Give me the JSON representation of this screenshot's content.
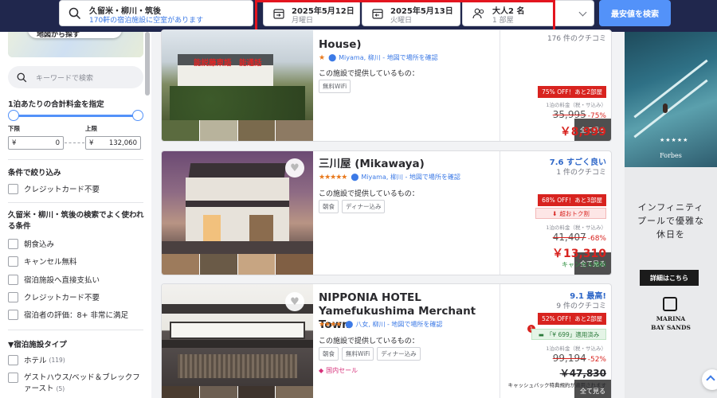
{
  "search": {
    "destination": "久留米・柳川・筑後",
    "availability": "170軒の宿泊施設に空室があります",
    "checkin_date": "2025年5月12日",
    "checkin_day": "月曜日",
    "checkout_date": "2025年5月13日",
    "checkout_day": "火曜日",
    "guests": "大人2 名",
    "rooms": "1 部屋",
    "button": "最安値を検索"
  },
  "map": {
    "label": "地図から探す"
  },
  "sidebar": {
    "keyword_placeholder": "キーワードで検索",
    "price_title": "1泊あたりの合計料金を指定",
    "min_label": "下限",
    "max_label": "上限",
    "currency": "¥",
    "min_value": "0",
    "max_value": "132,060",
    "filters_title": "条件で絞り込み",
    "filters": [
      "クレジットカード不要"
    ],
    "popular_title": "久留米・柳川・筑後の検索でよく使われる条件",
    "popular": [
      "朝食込み",
      "キャンセル無料",
      "宿泊施設へ直接支払い",
      "クレジットカード不要",
      "宿泊者の評価：8+ 非常に満足"
    ],
    "type_title": "▼宿泊施設タイプ",
    "types": [
      {
        "label": "ホテル",
        "count": "(119)"
      },
      {
        "label": "ゲストハウス/ベッド＆ブレックファースト",
        "count": "(5)"
      }
    ]
  },
  "hotels": [
    {
      "name": "House)",
      "photo_text": "能説藤東語　能通話",
      "location": "Miyama, 柳川 - 地図で場所を確認",
      "amenities_label": "この施設で提供しているもの：",
      "tags": [
        "無料WiFi"
      ],
      "see_all": "全て見る",
      "review_count": "176 件のクチコミ",
      "badge": "75% OFF！あと2部屋",
      "per_night": "1泊の料金（税・サ込み）",
      "old_price": "35,995",
      "discount": "-75%",
      "price": "￥8,999",
      "stars": 1
    },
    {
      "name": "三川屋 (Mikawaya)",
      "location": "Miyama, 柳川 - 地図で場所を確認",
      "amenities_label": "この施設で提供しているもの：",
      "tags": [
        "朝食",
        "ディナー込み"
      ],
      "see_all": "全て見る",
      "rating": "7.6 すごく良い",
      "review_count": "1 件のクチコミ",
      "badge": "68% OFF！あと3部屋",
      "deal": "超おトク割",
      "per_night": "1泊の料金（税・サ込み）",
      "old_price": "41,407",
      "discount": "-68%",
      "price": "￥13,310",
      "cancel": "キャンセル無料",
      "stars": 5
    },
    {
      "name": "NIPPONIA HOTEL Yamefukushima Merchant Town",
      "location": "八女, 柳川 - 地図で場所を確認",
      "amenities_label": "この施設で提供しているもの：",
      "tags": [
        "朝食",
        "無料WiFi",
        "ディナー込み"
      ],
      "promo": "国内セール",
      "see_all": "全て見る",
      "rating": "9.1 最高!",
      "review_count": "9 件のクチコミ",
      "badge": "52% OFF！あと2部屋",
      "coupon": "「¥ 699」適用済み",
      "coupon_count": "1",
      "per_night": "1泊の料金（税・サ込み）",
      "old_price": "99,194",
      "discount": "-52%",
      "price": "￥47,830",
      "cashback": "キャッシュバック特典規約が適用されます",
      "stars": 4
    }
  ],
  "ad": {
    "brand_top": "Forbes",
    "headline": "インフィニティプールで優雅な休日を",
    "cta": "詳細はこちら",
    "brand_bottom": "MARINA BAY SANDS"
  }
}
